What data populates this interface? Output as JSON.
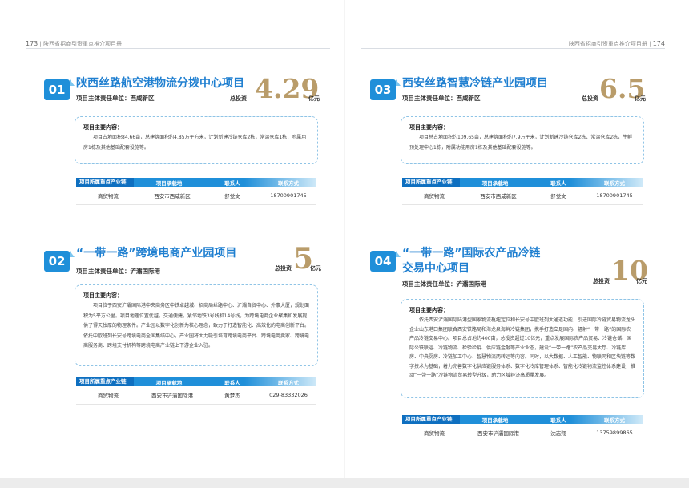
{
  "left_page": {
    "number": "173",
    "header": "陕西省招商引资重点推介项目册"
  },
  "right_page": {
    "number": "174",
    "header": "陕西省招商引资重点推介项目册"
  },
  "table_headers": [
    "项目所属重点产业链",
    "项目承载地",
    "联系人",
    "联系方式"
  ],
  "desc_heading": "项目主要内容：",
  "invest_label": "总投资",
  "invest_unit": "亿元",
  "projects": [
    {
      "no": "01",
      "title": "陕西丝路航空港物流分拨中心项目",
      "owner": "项目主体责任单位：西咸新区",
      "investment": "4.29",
      "description": "项目占地面积84.66亩，总建筑面积约4.85万平方米，计划新建冷链仓库2栋，常温仓库1栋，附属用房1栋及其他基础配套设施等。",
      "row": [
        "商贸物流",
        "西安市西咸新区",
        "舒觉文",
        "18700901745"
      ]
    },
    {
      "no": "02",
      "title": "“一带一路”跨境电商产业园项目",
      "owner": "项目主体责任单位：浐灞国际港",
      "investment": "5",
      "description": "项目位于西安浐灞国际港中央商务区中铁卓越城、招商局丝路中心、浐灞自贸中心、外事大厦，规划面积为5平方公里。项目地理位置优越，交通便捷，紧邻地铁3号线和14号线，为跨境电商企业聚集和发展提供了得天独厚的物理条件。产业园以数字化创新为核心理念，致力于打造智能化、高效化的电商创新平台。依托中欧班列长安号跨境电商全国集结中心，产业园将大力吸引培育跨境电商平台、跨境电商卖家、跨境电商服务商、跨境支付机构等跨境电商产业链上下游企业入驻。",
      "row": [
        "商贸物流",
        "西安市浐灞国际港",
        "黄梦杰",
        "029-83332026"
      ]
    },
    {
      "no": "03",
      "title": "西安丝路智慧冷链产业园项目",
      "owner": "项目主体责任单位：西咸新区",
      "investment": "6.5",
      "description": "项目总占地面积约109.65亩，总建筑面积约7.9万平米，计划新建冷链仓库2栋、常温仓库2栋，生鲜预处理中心1栋，附属功能用房1栋及其他基础配套设施等。",
      "row": [
        "商贸物流",
        "西安市西咸新区",
        "舒觉文",
        "18700901745"
      ]
    },
    {
      "no": "04",
      "title": "“一带一路”国际农产品冷链",
      "title2": "交易中心项目",
      "owner": "项目主体责任单位：浐灞国际港",
      "investment": "10",
      "description": "依托西安浐灞国际陆港型国家物流枢纽定位和长安号中欧班列大通道功能，引进国际冷链贸易物流龙头企业山东港口集团联合西安铁路局和海龙泉海鲜冷链集团，携手打造立足国内、辐射“一带一路”的国际农产品冷链交易中心。项目总占地约400亩，总投资超过10亿元，重点发展国际农产品贸易、冷链仓储、国际公铁联运、冷链物流、检验检疫、供应链金融等产业业态，建设“一带一路”农产品交易大厅、冷链库房、中央厨房、冷链加工中心、智慧物流两转运等内容。同时，以大数据、人工智能、物联网和区块链等数字技术为基础，着力完善数字化供应链服务体系、数字化冷库管理体系、智能化冷链物流监控体系建设，推动“一带一路”冷链物流贸易转型升级，助力区域经济高质量发展。",
      "row": [
        "商贸物流",
        "西安市浐灞国际港",
        "沈志翔",
        "13759899865"
      ]
    }
  ]
}
